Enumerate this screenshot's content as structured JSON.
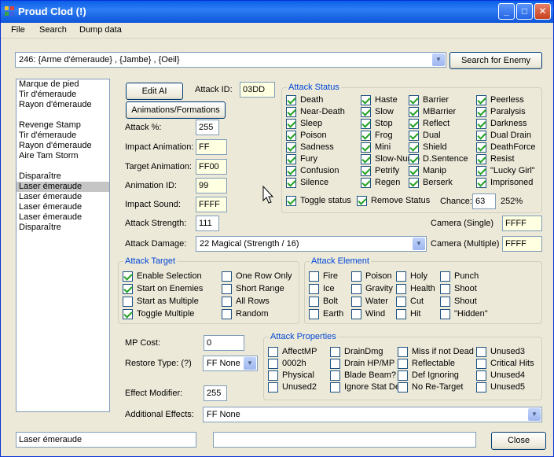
{
  "window": {
    "title": "Proud Clod (!)",
    "min": "_",
    "max": "□",
    "close": "✕"
  },
  "menu": [
    "File",
    "Search",
    "Dump data"
  ],
  "enemy_select": "246:  {Arme d'émeraude} , {Jambe} , {Oeil}",
  "search_button": "Search for Enemy",
  "attack_list": [
    "Marque de pied",
    "Tir d'émeraude",
    "Rayon d'émeraude",
    "",
    "Revenge Stamp",
    "Tir d'émeraude",
    "Rayon d'émeraude",
    "Aire Tam Storm",
    "",
    "Disparaître",
    "Laser émeraude",
    "Laser émeraude",
    "Laser émeraude",
    "Laser émeraude",
    "Disparaître"
  ],
  "selected_index": 10,
  "edit_ai": "Edit AI",
  "anims_button": "Animations/Formations",
  "attack_id": {
    "label": "Attack ID:",
    "value": "03DD"
  },
  "fields": {
    "attack_pct": {
      "label": "Attack %:",
      "value": "255"
    },
    "impact_anim": {
      "label": "Impact Animation:",
      "value": "FF"
    },
    "target_anim": {
      "label": "Target Animation:",
      "value": "FF00"
    },
    "anim_id": {
      "label": "Animation ID:",
      "value": "99"
    },
    "impact_sound": {
      "label": "Impact Sound:",
      "value": "FFFF"
    },
    "attack_strength": {
      "label": "Attack Strength:",
      "value": "111"
    },
    "attack_damage": {
      "label": "Attack Damage:",
      "value": "22 Magical (Strength / 16)"
    },
    "camera_single": {
      "label": "Camera (Single)",
      "value": "FFFF"
    },
    "camera_multiple": {
      "label": "Camera (Multiple)",
      "value": "FFFF"
    },
    "mp_cost": {
      "label": "MP Cost:",
      "value": "0"
    },
    "restore_type": {
      "label": "Restore Type: (?)",
      "value": "FF None"
    },
    "effect_modifier": {
      "label": "Effect Modifier:",
      "value": "255"
    },
    "additional_effects": {
      "label": "Additional Effects:",
      "value": "FF  None"
    }
  },
  "attack_status": {
    "title": "Attack Status",
    "items": [
      [
        "Death",
        true
      ],
      [
        "Haste",
        true
      ],
      [
        "Barrier",
        true
      ],
      [
        "Peerless",
        true
      ],
      [
        "Near-Death",
        true
      ],
      [
        "Slow",
        true
      ],
      [
        "MBarrier",
        true
      ],
      [
        "Paralysis",
        true
      ],
      [
        "Sleep",
        true
      ],
      [
        "Stop",
        true
      ],
      [
        "Reflect",
        true
      ],
      [
        "Darkness",
        true
      ],
      [
        "Poison",
        true
      ],
      [
        "Frog",
        true
      ],
      [
        "Dual",
        true
      ],
      [
        "Dual Drain",
        true
      ],
      [
        "Sadness",
        true
      ],
      [
        "Mini",
        true
      ],
      [
        "Shield",
        true
      ],
      [
        "DeathForce",
        true
      ],
      [
        "Fury",
        true
      ],
      [
        "Slow-Numb",
        true
      ],
      [
        "D.Sentence",
        true
      ],
      [
        "Resist",
        true
      ],
      [
        "Confusion",
        true
      ],
      [
        "Petrify",
        true
      ],
      [
        "Manip",
        true
      ],
      [
        "\"Lucky Girl\"",
        true
      ],
      [
        "Silence",
        true
      ],
      [
        "Regen",
        true
      ],
      [
        "Berserk",
        true
      ],
      [
        "Imprisoned",
        true
      ]
    ],
    "toggle": "Toggle status",
    "remove": "Remove Status",
    "chance_label": "Chance:",
    "chance_value": "63",
    "chance_pct": "252%"
  },
  "attack_target": {
    "title": "Attack Target",
    "items": [
      [
        "Enable Selection",
        true
      ],
      [
        "One Row Only",
        false
      ],
      [
        "Start on Enemies",
        true
      ],
      [
        "Short Range",
        false
      ],
      [
        "Start as Multiple",
        false
      ],
      [
        "All Rows",
        false
      ],
      [
        "Toggle Multiple",
        true
      ],
      [
        "Random",
        false
      ]
    ]
  },
  "attack_element": {
    "title": "Attack Element",
    "items": [
      [
        "Fire",
        false
      ],
      [
        "Poison",
        false
      ],
      [
        "Holy",
        false
      ],
      [
        "Punch",
        false
      ],
      [
        "Ice",
        false
      ],
      [
        "Gravity",
        false
      ],
      [
        "Health",
        false
      ],
      [
        "Shoot",
        false
      ],
      [
        "Bolt",
        false
      ],
      [
        "Water",
        false
      ],
      [
        "Cut",
        false
      ],
      [
        "Shout",
        false
      ],
      [
        "Earth",
        false
      ],
      [
        "Wind",
        false
      ],
      [
        "Hit",
        false
      ],
      [
        "\"Hidden\"",
        false
      ]
    ]
  },
  "attack_properties": {
    "title": "Attack Properties",
    "items": [
      [
        "AffectMP",
        false
      ],
      [
        "DrainDmg",
        false
      ],
      [
        "Miss if not Dead",
        false
      ],
      [
        "Unused3",
        false
      ],
      [
        "0002h",
        false
      ],
      [
        "Drain HP/MP",
        false
      ],
      [
        "Reflectable",
        false
      ],
      [
        "Critical Hits",
        false
      ],
      [
        "Physical",
        false
      ],
      [
        "Blade Beam?",
        false
      ],
      [
        "Def Ignoring",
        false
      ],
      [
        "Unused4",
        false
      ],
      [
        "Unused2",
        false
      ],
      [
        "Ignore Stat Def",
        false
      ],
      [
        "No Re-Target",
        false
      ],
      [
        "Unused5",
        false
      ]
    ]
  },
  "footer": {
    "name": "Laser émeraude",
    "status": "",
    "close": "Close"
  }
}
